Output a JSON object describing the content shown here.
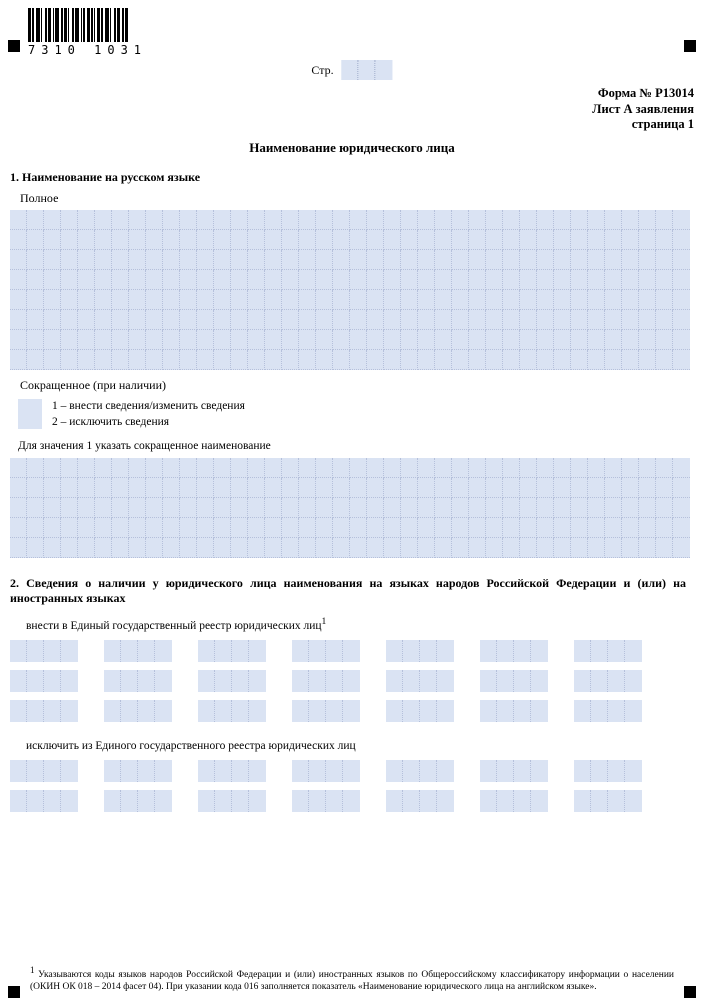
{
  "barcode_number": "7310 1031",
  "page_label": "Стр.",
  "header": {
    "form_no": "Форма № Р13014",
    "sheet": "Лист А заявления",
    "page": "страница 1"
  },
  "title": "Наименование юридического лица",
  "section1": {
    "heading": "1. Наименование на русском языке",
    "full_label": "Полное",
    "short_label": "Сокращенное (при наличии)",
    "option1": "1 – внести сведения/изменить сведения",
    "option2": "2 – исключить сведения",
    "instruction": "Для значения 1 указать сокращенное наименование"
  },
  "section2": {
    "heading": "2. Сведения о наличии у юридического лица наименования на языках народов Российской Федерации и (или) на иностранных языках",
    "add_label": "внести в Единый государственный реестр юридических лиц",
    "add_sup": "1",
    "remove_label": "исключить из Единого государственного реестра юридических лиц"
  },
  "footnote": {
    "sup": "1",
    "text": "Указываются коды языков народов Российской Федерации и (или) иностранных языков по Общероссийскому классификатору информации о населении (ОКИН ОК 018 – 2014 фасет 04). При указании кода 016 заполняется показатель «Наименование юридического лица на английском языке»."
  }
}
